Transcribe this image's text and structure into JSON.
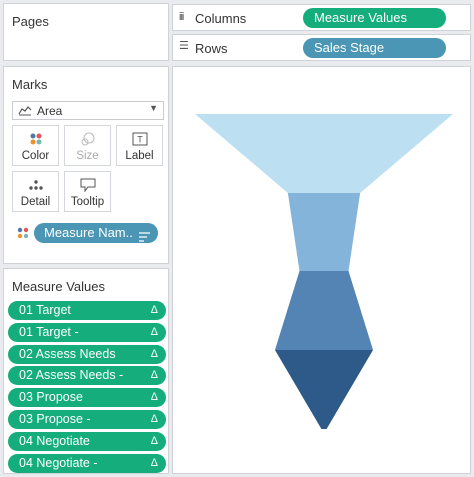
{
  "pages": {
    "title": "Pages"
  },
  "columns": {
    "icon": "columns-icon",
    "label": "Columns",
    "pill": "Measure Values"
  },
  "rows": {
    "icon": "rows-icon",
    "label": "Rows",
    "pill": "Sales  Stage"
  },
  "marks": {
    "title": "Marks",
    "type": {
      "icon": "area-chart-icon",
      "label": "Area"
    },
    "buttons": [
      {
        "id": "color",
        "icon": "color-dots-icon",
        "label": "Color"
      },
      {
        "id": "size",
        "icon": "size-icon",
        "label": "Size",
        "disabled": true
      },
      {
        "id": "label",
        "icon": "text-label-icon",
        "label": "Label"
      },
      {
        "id": "detail",
        "icon": "detail-dots-icon",
        "label": "Detail"
      },
      {
        "id": "tooltip",
        "icon": "speech-bubble-icon",
        "label": "Tooltip"
      }
    ],
    "field_pill": "Measure Nam.."
  },
  "measure_values": {
    "title": "Measure Values",
    "items": [
      "01 Target",
      "01 Target -",
      "02 Assess Needs",
      "02 Assess Needs -",
      "03 Propose",
      "03 Propose -",
      "04 Negotiate",
      "04 Negotiate -"
    ],
    "delta_symbol": "Δ"
  },
  "colors": {
    "pill_green": "#15ad7c",
    "pill_blue": "#4a96b4",
    "stage_1": "#bcdff1",
    "stage_2": "#84b4d9",
    "stage_3": "#5484b4",
    "stage_4": "#2e5a8a"
  },
  "chart_data": {
    "type": "area",
    "description_of_axes": "",
    "categories": [
      "01",
      "02",
      "03",
      "04"
    ],
    "series": [
      {
        "values": [
          1.0,
          0.19,
          0.33,
          0.0
        ]
      }
    ]
  }
}
